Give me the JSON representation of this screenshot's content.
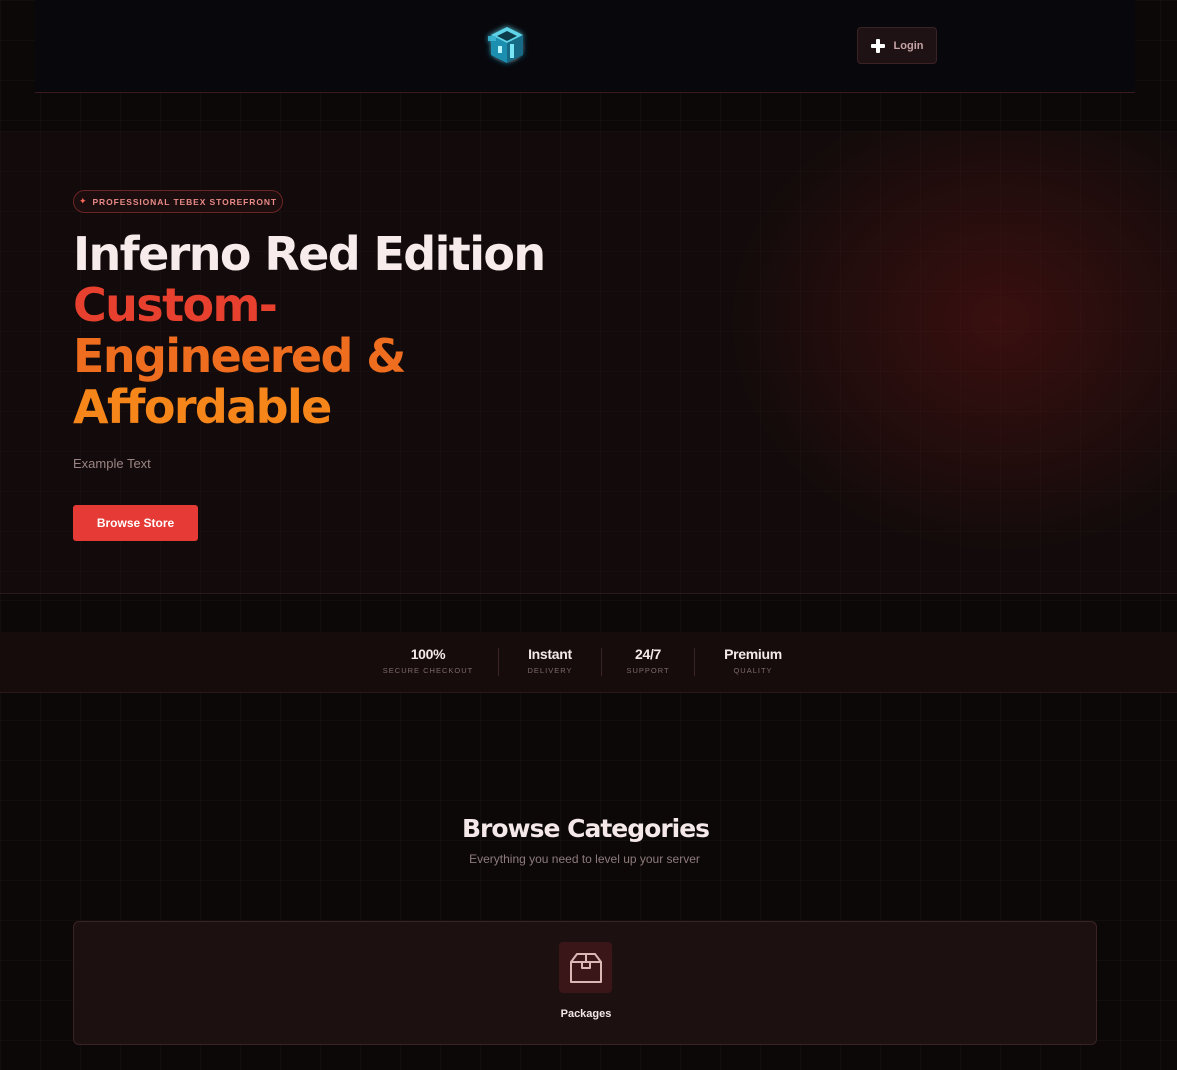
{
  "header": {
    "logo_icon": "cube-logo-icon",
    "login_label": "Login",
    "login_icon": "plus-icon"
  },
  "hero": {
    "badge_icon": "sparkle-icon",
    "badge_star": "✦",
    "badge_text": "PROFESSIONAL TEBEX STOREFRONT",
    "title_line1": "Inferno Red Edition",
    "title_line2": "Custom-",
    "title_line3": "Engineered &",
    "title_line4": "Affordable",
    "subtitle": "Example Text",
    "cta_label": "Browse Store"
  },
  "stats": [
    {
      "value": "100%",
      "label": "SECURE CHECKOUT"
    },
    {
      "value": "Instant",
      "label": "DELIVERY"
    },
    {
      "value": "24/7",
      "label": "SUPPORT"
    },
    {
      "value": "Premium",
      "label": "QUALITY"
    }
  ],
  "categories": {
    "title": "Browse Categories",
    "subtitle": "Everything you need to level up your server",
    "items": [
      {
        "label": "Packages",
        "icon": "package-box-icon"
      }
    ]
  },
  "colors": {
    "accent_red": "#e53a36",
    "accent_orange": "#f7861a",
    "background": "#0d0808"
  }
}
